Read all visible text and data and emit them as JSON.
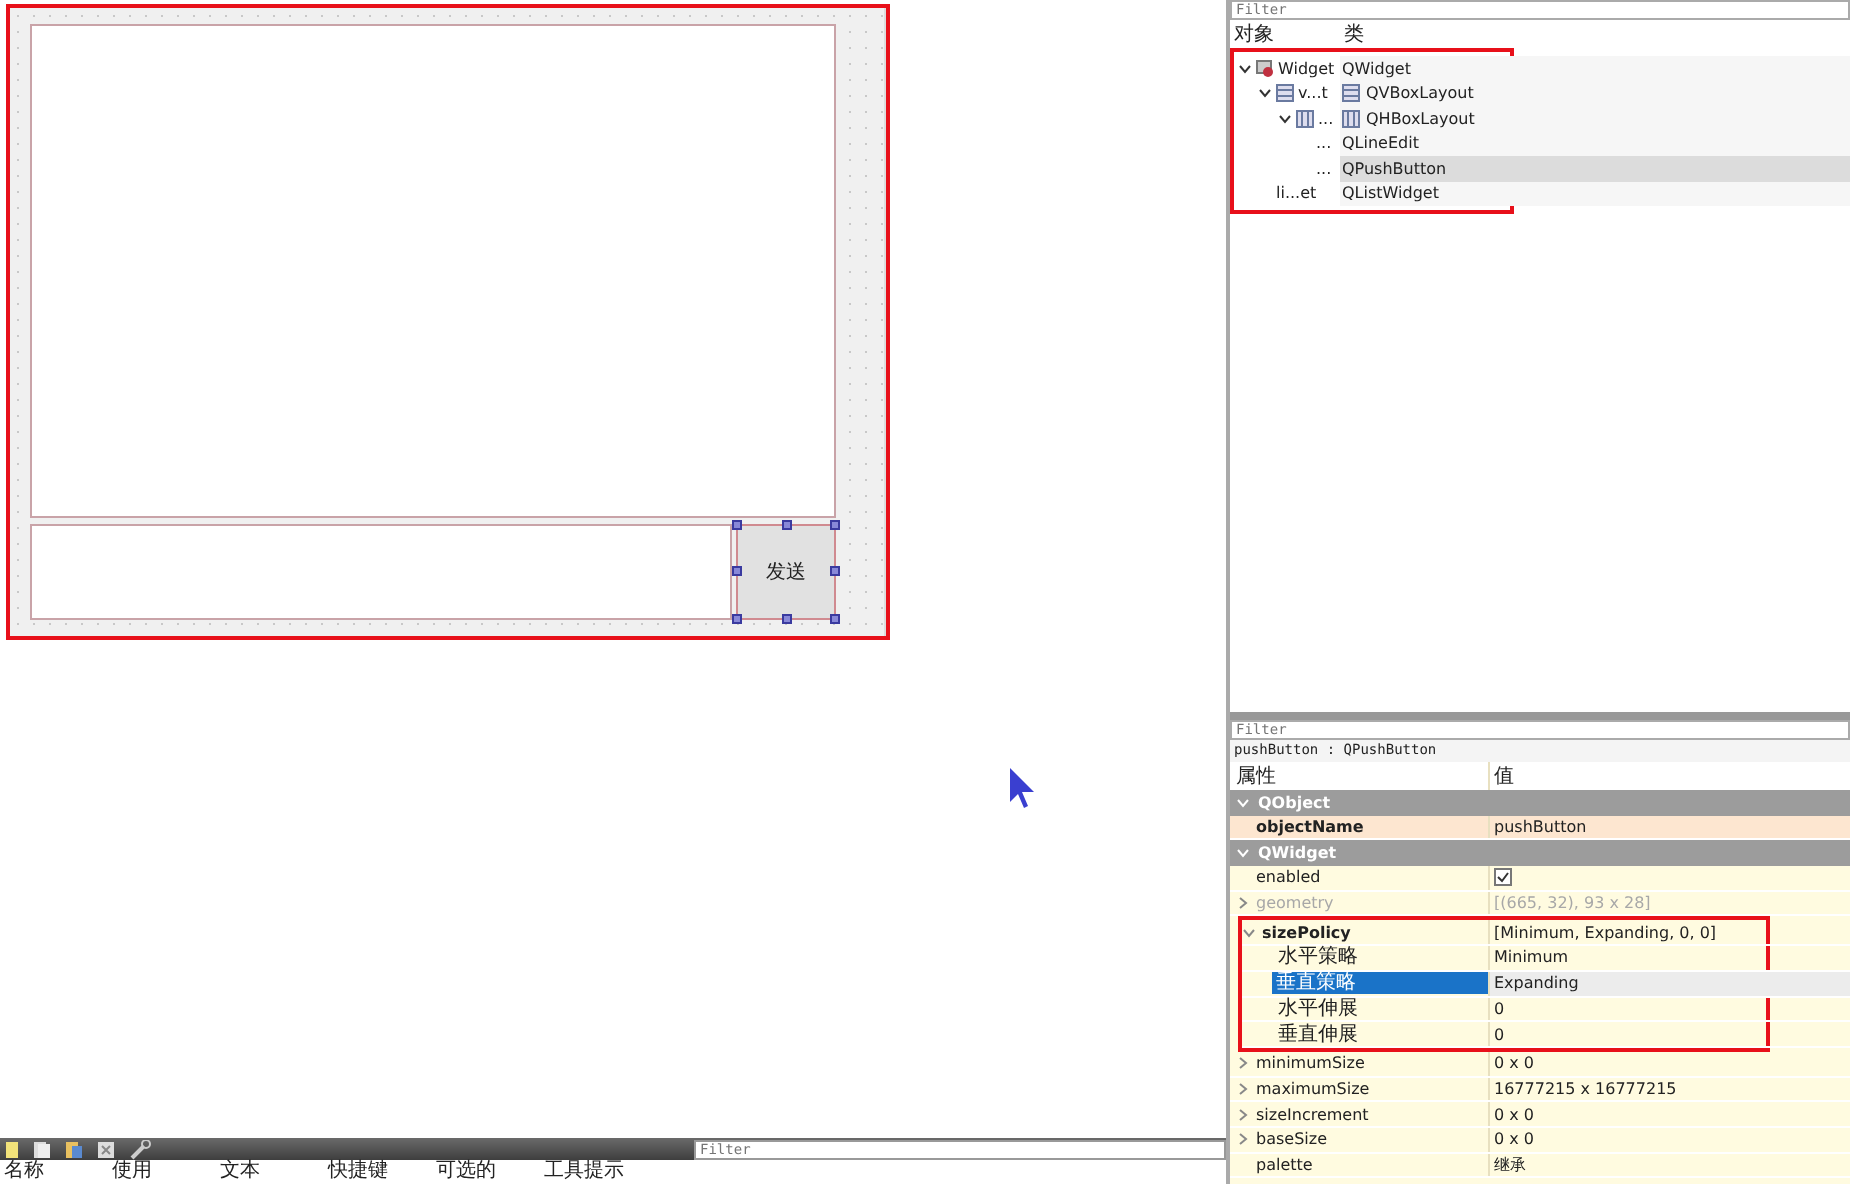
{
  "form": {
    "highlighted": true,
    "button": {
      "label": "发送",
      "selected": true
    }
  },
  "object_inspector": {
    "filter": {
      "placeholder": "Filter"
    },
    "columns": [
      "对象",
      "类"
    ],
    "highlighted": true,
    "tree": [
      {
        "name": "Widget",
        "class": "QWidget",
        "kind": "widget",
        "expanded": true,
        "selected": false,
        "children": [
          {
            "name": "v...t",
            "class": "QVBoxLayout",
            "kind": "vlayout",
            "expanded": true,
            "selected": false,
            "children": [
              {
                "name": "...",
                "class": "QHBoxLayout",
                "kind": "hlayout",
                "expanded": true,
                "selected": false,
                "children": [
                  {
                    "name": "...",
                    "class": "QLineEdit",
                    "selected": false
                  },
                  {
                    "name": "...",
                    "class": "QPushButton",
                    "selected": true
                  }
                ]
              }
            ]
          },
          {
            "name": "li...et",
            "class": "QListWidget",
            "selected": false
          }
        ]
      }
    ]
  },
  "property_editor": {
    "filter": {
      "placeholder": "Filter"
    },
    "caption": "pushButton : QPushButton",
    "columns": [
      "属性",
      "值"
    ],
    "groups": [
      {
        "name": "QObject",
        "expanded": true,
        "properties": [
          {
            "name": "objectName",
            "value": "pushButton",
            "kind": "text",
            "bold": true,
            "modified": true,
            "selected": false
          }
        ]
      },
      {
        "name": "QWidget",
        "expanded": true,
        "properties": [
          {
            "name": "enabled",
            "kind": "check",
            "checked": true,
            "selected": false
          },
          {
            "name": "geometry",
            "value": "[(665, 32), 93 x 28]",
            "kind": "text",
            "disabled": true,
            "expanded": false,
            "selected": false
          },
          {
            "name": "sizePolicy",
            "value": "[Minimum, Expanding, 0, 0]",
            "kind": "text",
            "bold": true,
            "expanded": true,
            "highlighted": true,
            "selected": false,
            "children": [
              {
                "name": "水平策略",
                "value": "Minimum",
                "kind": "text",
                "selected": false
              },
              {
                "name": "垂直策略",
                "value": "Expanding",
                "kind": "text",
                "selected": true
              },
              {
                "name": "水平伸展",
                "value": "0",
                "kind": "text",
                "selected": false
              },
              {
                "name": "垂直伸展",
                "value": "0",
                "kind": "text",
                "selected": false
              }
            ]
          },
          {
            "name": "minimumSize",
            "value": "0 x 0",
            "kind": "text",
            "expanded": false,
            "selected": false
          },
          {
            "name": "maximumSize",
            "value": "16777215 x 16777215",
            "kind": "text",
            "expanded": false,
            "selected": false
          },
          {
            "name": "sizeIncrement",
            "value": "0 x 0",
            "kind": "text",
            "expanded": false,
            "selected": false
          },
          {
            "name": "baseSize",
            "value": "0 x 0",
            "kind": "text",
            "expanded": false,
            "selected": false
          },
          {
            "name": "palette",
            "value": "继承",
            "kind": "text",
            "selected": false
          }
        ]
      }
    ]
  },
  "action_editor": {
    "filter": {
      "placeholder": "Filter"
    },
    "columns": [
      "名称",
      "使用",
      "文本",
      "快捷键",
      "可选的",
      "工具提示"
    ]
  }
}
